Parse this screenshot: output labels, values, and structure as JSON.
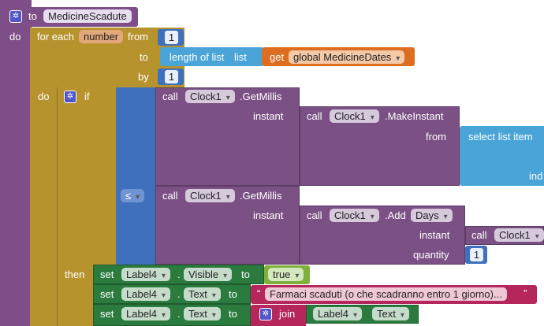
{
  "procedure": {
    "to_label": "to",
    "name": "MedicineScadute",
    "do_label": "do"
  },
  "loop": {
    "for_each_label": "for each",
    "var_name": "number",
    "from_label": "from",
    "from_value": "1",
    "to_label": "to",
    "by_label": "by",
    "by_value": "1",
    "do_label": "do",
    "length_label": "length of list",
    "list_label": "list",
    "get_label": "get",
    "global_var": "global MedicineDates"
  },
  "if_block": {
    "if_label": "if",
    "then_label": "then",
    "compare_op": "≤"
  },
  "call1": {
    "call_label": "call",
    "component": "Clock1",
    "method": ".GetMillis",
    "instant_label": "instant",
    "inner_call": "call",
    "inner_component": "Clock1",
    "inner_method": ".MakeInstant",
    "from_label": "from",
    "select_label": "select list item",
    "index_label": "ind"
  },
  "call2": {
    "call_label": "call",
    "component": "Clock1",
    "method": ".GetMillis",
    "instant_label": "instant",
    "inner_call": "call",
    "inner_component": "Clock1",
    "inner_method": ".Add",
    "unit": "Days",
    "instant2_label": "instant",
    "call3": "call",
    "component3": "Clock1",
    "quantity_label": "quantity",
    "quantity_value": "1"
  },
  "then_blocks": [
    {
      "set": "set",
      "component": "Label4",
      "dot": ".",
      "property": "Visible",
      "to": "to",
      "value": "true"
    },
    {
      "set": "set",
      "component": "Label4",
      "dot": ".",
      "property": "Text",
      "to": "to",
      "value": "Farmaci scaduti (o che scadranno entro 1 giorno)..."
    },
    {
      "set": "set",
      "component": "Label4",
      "dot": ".",
      "property": "Text",
      "to": "to",
      "join": "join",
      "join_component": "Label4",
      "join_property": "Text"
    }
  ],
  "colors": {
    "procedure": "#7d4e87",
    "loop": "#b7932e",
    "control": "#b7932e",
    "math": "#3f70be",
    "list": "#4aa4d8",
    "variable": "#dd6e21",
    "component": "#7b5185",
    "setter": "#2b7b3e",
    "logic": "#7fb03c",
    "text": "#b5265b"
  }
}
